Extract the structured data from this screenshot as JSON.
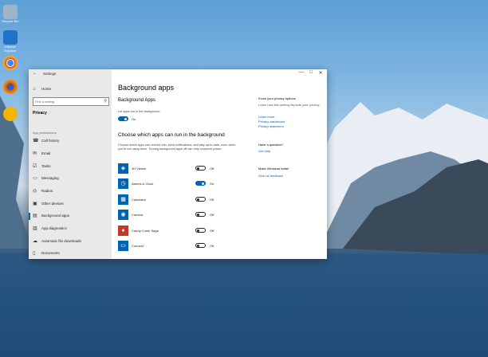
{
  "desktop_icons": [
    {
      "name": "recycle-bin-icon",
      "label": "Recycle Bin",
      "color": "#9fb4c8"
    },
    {
      "name": "onedrive-icon",
      "label": "Internet Explorer",
      "color": "#1e73c6"
    },
    {
      "name": "chrome-icon",
      "label": "",
      "color": "#34a853"
    },
    {
      "name": "firefox-icon",
      "label": "",
      "color": "#e66000"
    },
    {
      "name": "app-icon",
      "label": "",
      "color": "#f4b400"
    }
  ],
  "window": {
    "title": "Settings",
    "controls": {
      "minimize": "—",
      "maximize": "□",
      "close": "✕"
    }
  },
  "sidebar": {
    "home": "Home",
    "search_placeholder": "Find a setting",
    "section": "Privacy",
    "group_label": "App permissions",
    "items": [
      {
        "label": "Call history",
        "icon": "phone-icon"
      },
      {
        "label": "Email",
        "icon": "mail-icon"
      },
      {
        "label": "Tasks",
        "icon": "tasks-icon"
      },
      {
        "label": "Messaging",
        "icon": "message-icon"
      },
      {
        "label": "Radios",
        "icon": "radio-icon"
      },
      {
        "label": "Other devices",
        "icon": "devices-icon"
      },
      {
        "label": "Background apps",
        "icon": "background-apps-icon"
      },
      {
        "label": "App diagnostics",
        "icon": "diagnostics-icon"
      },
      {
        "label": "Automatic file downloads",
        "icon": "download-icon"
      },
      {
        "label": "Documents",
        "icon": "document-icon"
      }
    ]
  },
  "main": {
    "title": "Background apps",
    "section1": "Background Apps",
    "let_apps_label": "Let apps run in the background",
    "let_apps_state": "On",
    "section2": "Choose which apps can run in the background",
    "description": "Choose which apps can receive info, send notifications, and stay up-to-date, even when you're not using them. Turning background apps off can help conserve power.",
    "apps": [
      {
        "name": "3D Viewer",
        "state": "Off",
        "on": false,
        "icon_color": "#0063b1",
        "glyph": "◈"
      },
      {
        "name": "Alarms & Clock",
        "state": "On",
        "on": true,
        "icon_color": "#0063b1",
        "glyph": "◷"
      },
      {
        "name": "Calculator",
        "state": "Off",
        "on": false,
        "icon_color": "#0063b1",
        "glyph": "▦"
      },
      {
        "name": "Camera",
        "state": "Off",
        "on": false,
        "icon_color": "#0063b1",
        "glyph": "◉"
      },
      {
        "name": "Candy Crush Saga",
        "state": "Off",
        "on": false,
        "icon_color": "#c0392b",
        "glyph": "●"
      },
      {
        "name": "Connect",
        "state": "Off",
        "on": false,
        "icon_color": "#0063b1",
        "glyph": "▭"
      }
    ]
  },
  "right": {
    "know_title": "Know your privacy options",
    "know_text": "Learn how this setting impacts your privacy.",
    "links": [
      "Learn more",
      "Privacy dashboard",
      "Privacy statement"
    ],
    "question_title": "Have a question?",
    "get_help": "Get help",
    "better_title": "Make Windows better",
    "feedback": "Give us feedback"
  }
}
